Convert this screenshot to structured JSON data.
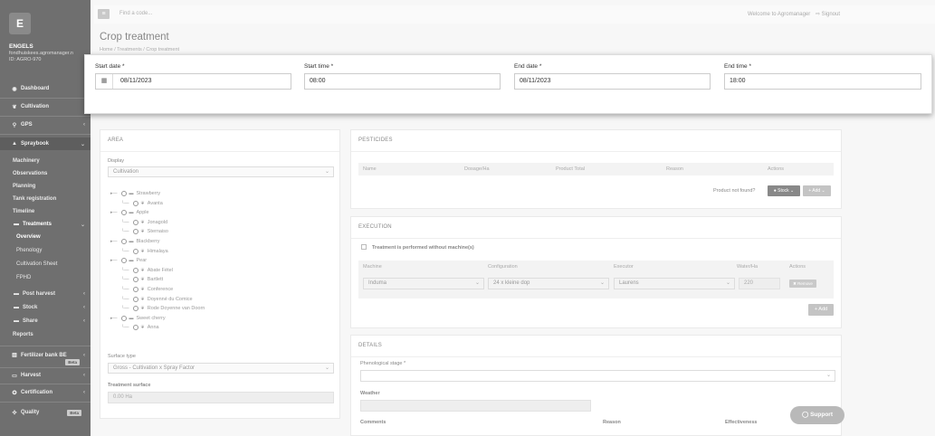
{
  "user": {
    "initial": "E",
    "name": "ENGELS",
    "email": "fondhuiskees.agromanager.n",
    "id": "ID: AGRO-970"
  },
  "sidebar": {
    "items": [
      {
        "label": "Dashboard",
        "icon": "gauge-icon"
      },
      {
        "label": "Cultivation",
        "icon": "leaf-icon"
      },
      {
        "label": "GPS",
        "icon": "map-pin-icon"
      },
      {
        "label": "Spraybook",
        "icon": "spray-icon"
      }
    ],
    "spraybook_children": [
      "Machinery",
      "Observations",
      "Planning",
      "Tank registration",
      "Timeline"
    ],
    "treatments": {
      "label": "Treatments",
      "icon": "folder-icon"
    },
    "treatments_children": [
      "Overview",
      "Phenology",
      "Cultivation Sheet",
      "FPHD"
    ],
    "lower": [
      {
        "label": "Post harvest",
        "icon": "folder-icon"
      },
      {
        "label": "Stock",
        "icon": "folder-icon"
      },
      {
        "label": "Share",
        "icon": "folder-icon"
      },
      {
        "label": "Reports",
        "icon": ""
      }
    ],
    "bottom": [
      {
        "label": "Fertilizer bank BE",
        "icon": "bank-icon",
        "badge": "Beta"
      },
      {
        "label": "Harvest",
        "icon": "box-icon"
      },
      {
        "label": "Certification",
        "icon": "certificate-icon"
      },
      {
        "label": "Quality",
        "icon": "quality-icon",
        "badge": "Beta"
      }
    ]
  },
  "topbar": {
    "menu_icon": "hamburger-icon",
    "search_placeholder": "Find a code...",
    "welcome": "Welcome to Agromanager",
    "signout": "Signout"
  },
  "page": {
    "title": "Crop treatment",
    "breadcrumb": "Home  /  Treatments  /  Crop treatment"
  },
  "datetime": {
    "start_date_label": "Start date *",
    "start_date": "08/11/2023",
    "start_time_label": "Start time *",
    "start_time": "08:00",
    "end_date_label": "End date *",
    "end_date": "08/11/2023",
    "end_time_label": "End time *",
    "end_time": "18:00"
  },
  "area": {
    "title": "AREA",
    "display_label": "Display",
    "display_value": "Cultivation",
    "tree": [
      {
        "label": "Strawberry",
        "level": 0
      },
      {
        "label": "Avanta",
        "level": 1
      },
      {
        "label": "Apple",
        "level": 0
      },
      {
        "label": "Jonagold",
        "level": 1
      },
      {
        "label": "Sternaiso",
        "level": 1
      },
      {
        "label": "Blackberry",
        "level": 0
      },
      {
        "label": "Himalaya",
        "level": 1
      },
      {
        "label": "Pear",
        "level": 0
      },
      {
        "label": "Abate Fétel",
        "level": 1
      },
      {
        "label": "Bartlett",
        "level": 1
      },
      {
        "label": "Conference",
        "level": 1
      },
      {
        "label": "Doyenné du Comice",
        "level": 1
      },
      {
        "label": "Rode Doyenne van Doorn",
        "level": 1
      },
      {
        "label": "Sweet cherry",
        "level": 0
      },
      {
        "label": "Anna",
        "level": 1
      }
    ],
    "surface_type_label": "Surface type",
    "surface_type_value": "Gross - Cultivation x Spray Factor",
    "treatment_surface_label": "Treatment surface",
    "treatment_surface_value": "0.00 Ha"
  },
  "pesticides": {
    "title": "PESTICIDES",
    "columns": [
      "Name",
      "Dosage/Ha",
      "Product Total",
      "Reason",
      "Actions"
    ],
    "not_found": "Product not found?",
    "stock_btn": "Stock",
    "add_btn": "+ Add"
  },
  "execution": {
    "title": "EXECUTION",
    "no_machine_label": "Treatment is performed without machine(s)",
    "columns": [
      "Machine",
      "Configuration",
      "Executor",
      "Water/Ha",
      "Actions"
    ],
    "row": {
      "machine": "Induma",
      "configuration": "24 x kleine dop",
      "executor": "Laurens",
      "water": "220",
      "remove": "Remove"
    },
    "add_btn": "+ Add"
  },
  "details": {
    "title": "DETAILS",
    "phenological_label": "Phenological stage *",
    "weather_label": "Weather",
    "comments_label": "Comments",
    "reason_label": "Reason",
    "effectiveness_label": "Effectiveness"
  },
  "support": {
    "label": "Support"
  }
}
